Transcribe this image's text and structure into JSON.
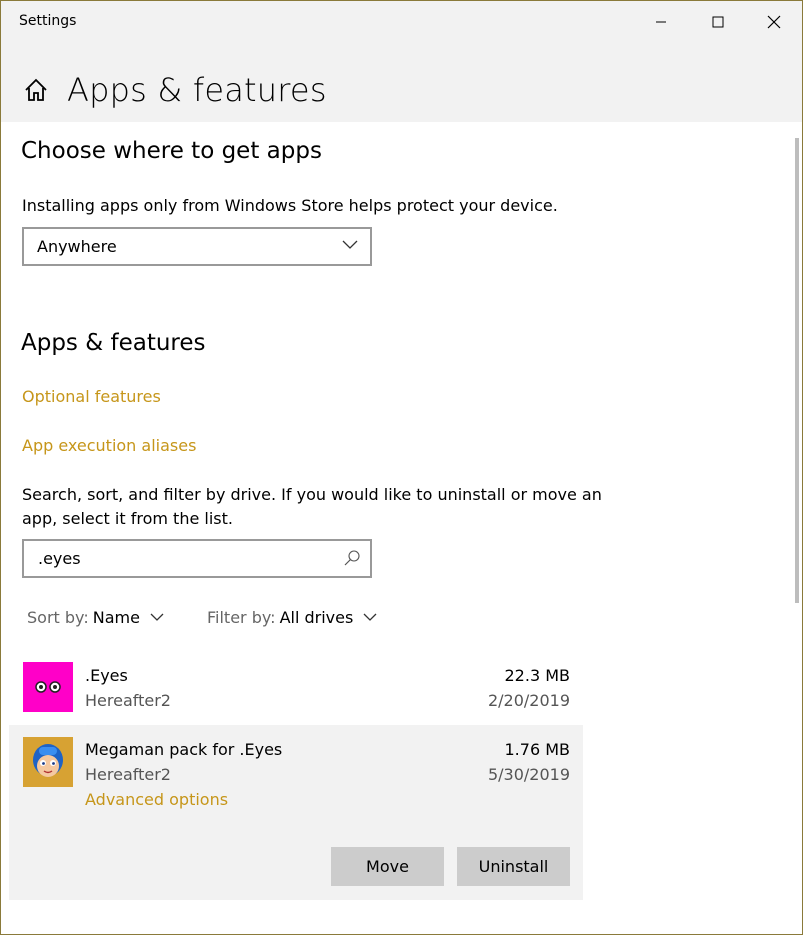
{
  "window": {
    "title": "Settings"
  },
  "header": {
    "title": "Apps & features"
  },
  "choose_section": {
    "heading": "Choose where to get apps",
    "description": "Installing apps only from Windows Store helps protect your device.",
    "dropdown_value": "Anywhere"
  },
  "apps_section": {
    "heading": "Apps & features",
    "links": [
      "Optional features",
      "App execution aliases"
    ],
    "description_line1": "Search, sort, and filter by drive. If you would like to uninstall or move an",
    "description_line2": "app, select it from the list.",
    "search_value": ".eyes",
    "sort_label": "Sort by:",
    "sort_value": "Name",
    "filter_label": "Filter by:",
    "filter_value": "All drives"
  },
  "apps": [
    {
      "name": ".Eyes",
      "publisher": "Hereafter2",
      "size": "22.3 MB",
      "date": "2/20/2019",
      "icon": "eyes-app-icon"
    },
    {
      "name": "Megaman pack for .Eyes",
      "publisher": "Hereafter2",
      "size": "1.76 MB",
      "date": "5/30/2019",
      "icon": "megaman-app-icon",
      "advanced_options": "Advanced options",
      "move_label": "Move",
      "uninstall_label": "Uninstall"
    }
  ],
  "colors": {
    "accent_link": "#c6961a",
    "titlebar_bg": "#f2f2f2",
    "selected_row_bg": "#f2f2f2",
    "button_bg": "#cccccc",
    "eyes_icon_bg": "#ff00c8",
    "megaman_icon_bg": "#d7a233"
  }
}
